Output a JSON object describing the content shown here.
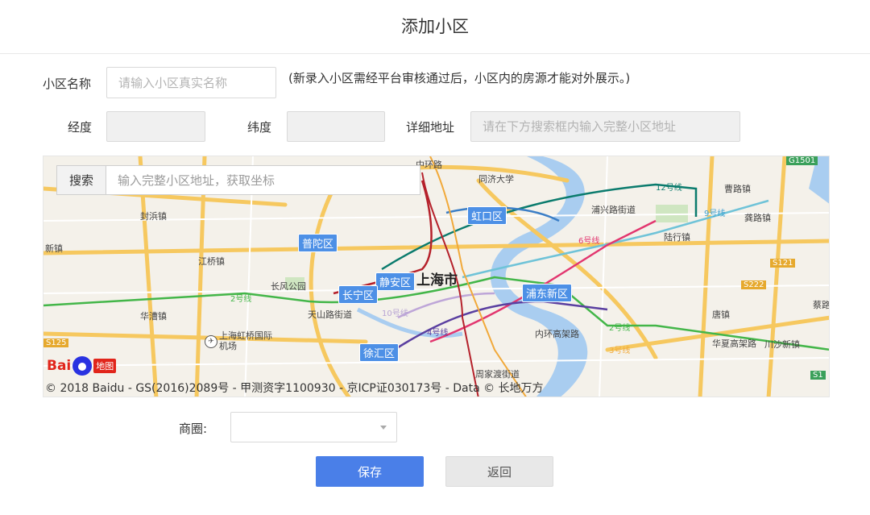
{
  "dialog": {
    "title": "添加小区"
  },
  "form": {
    "name_label": "小区名称",
    "name_placeholder": "请输入小区真实名称",
    "name_hint": "(新录入小区需经平台审核通过后，小区内的房源才能对外展示。)",
    "lng_label": "经度",
    "lat_label": "纬度",
    "address_label": "详细地址",
    "address_placeholder": "请在下方搜索框内输入完整小区地址",
    "business_label": "商圈:",
    "business_value": ""
  },
  "map": {
    "search_button": "搜索",
    "search_placeholder": "输入完整小区地址，获取坐标",
    "copyright": "© 2018 Baidu - GS(2016)2089号 - 甲测资字1100930 - 京ICP证030173号 - Data © 长地万方",
    "logo": {
      "bai": "Bai",
      "map_text": "地图"
    },
    "district_badges": [
      "普陀区",
      "虹口区",
      "静安区",
      "长宁区",
      "浦东新区",
      "徐汇区"
    ],
    "city_label": "上海市",
    "place_labels": [
      "中环路",
      "同济大学",
      "曹路镇",
      "浦兴路街道",
      "龚路镇",
      "封浜镇",
      "陆行镇",
      "新镇",
      "江桥镇",
      "长风公园",
      "天山路街道",
      "华漕镇",
      "上海虹桥国际机场",
      "内环高架路",
      "唐镇",
      "华夏高架路",
      "川沙新镇",
      "周家渡街道",
      "蔡路"
    ],
    "line_labels": [
      "12号线",
      "9号线",
      "6号线",
      "2号线",
      "10号线",
      "4号线",
      "3号线",
      "2号线"
    ],
    "road_badges": [
      "S121",
      "S222",
      "S125",
      "S1",
      "G1501"
    ]
  },
  "actions": {
    "save": "保存",
    "back": "返回"
  },
  "colors": {
    "primary": "#4a7fe8",
    "badge": "#4d90e6"
  }
}
